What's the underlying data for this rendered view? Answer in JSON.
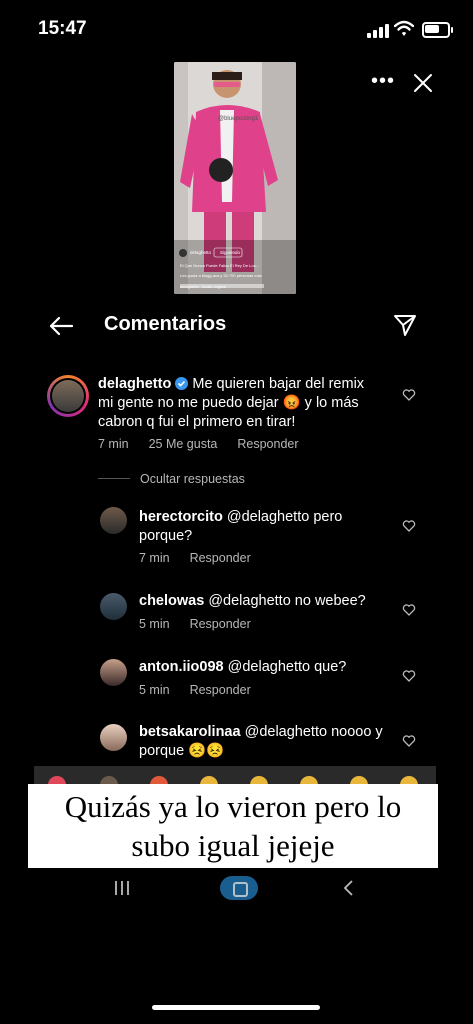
{
  "status": {
    "time": "15:47"
  },
  "video": {
    "watermark": "@blueposting1",
    "username": "delaghetto",
    "follow": "Siguiendo",
    "caption": "El Que Nunca Puede Faltar El Rey De Los...",
    "liked_by": "Les gusta a blugg.aca y 32.700 personas más",
    "audio": "delaghetto · Audio original"
  },
  "header": {
    "title": "Comentarios"
  },
  "main_comment": {
    "username": "delaghetto",
    "verified": true,
    "text_lines": [
      "Me quieren bajar del remix",
      "mi gente no me puedo dejar 😡 y lo más",
      "cabron q fui el primero en tirar!"
    ],
    "time": "7 min",
    "likes": "25 Me gusta",
    "reply": "Responder"
  },
  "hide_replies": "Ocultar respuestas",
  "replies": [
    {
      "username": "herectorcito",
      "text_lines": [
        "@delaghetto pero",
        "porque?"
      ],
      "time": "7 min",
      "reply": "Responder"
    },
    {
      "username": "chelowas",
      "text_lines": [
        "@delaghetto no webee?"
      ],
      "time": "5 min",
      "reply": "Responder"
    },
    {
      "username": "anton.iio098",
      "text_lines": [
        "@delaghetto que?"
      ],
      "time": "5 min",
      "reply": "Responder"
    },
    {
      "username": "betsakarolinaa",
      "text_lines": [
        "@delaghetto noooo y",
        "porque 😣😣"
      ]
    }
  ],
  "banner": {
    "lines": [
      "Quizás ya lo vieron pero lo",
      "subo igual jejeje"
    ]
  },
  "colors": {
    "background": "#000000",
    "text": "#ffffff",
    "meta": "#b7b7b7",
    "verified": "#3897f0",
    "jacket": "#e0418b"
  },
  "icons": [
    "cellular-signal-icon",
    "wifi-icon",
    "battery-icon",
    "more-icon",
    "close-icon",
    "back-arrow-icon",
    "send-icon",
    "heart-icon",
    "verified-icon"
  ]
}
